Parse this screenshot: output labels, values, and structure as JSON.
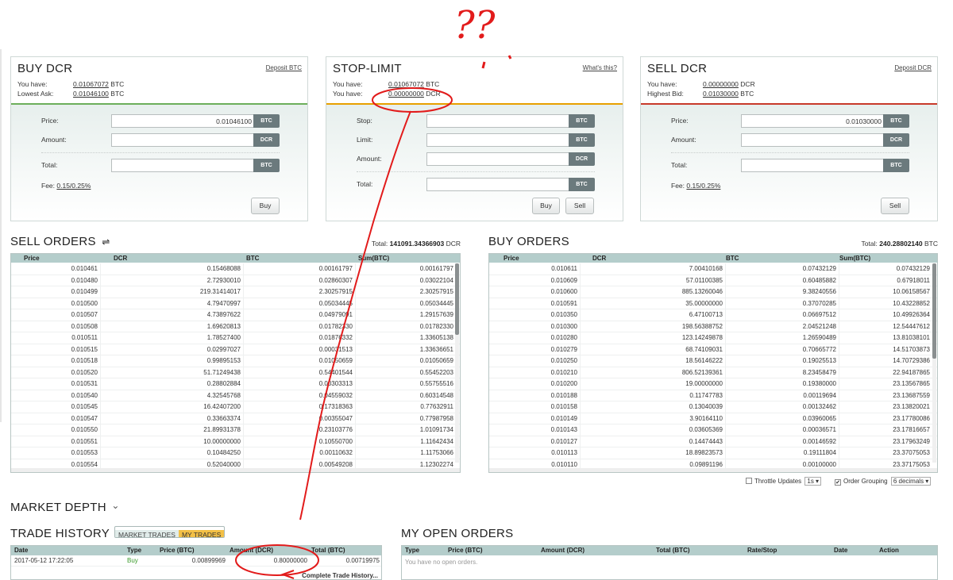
{
  "buy": {
    "title": "BUY DCR",
    "deposit_link": "Deposit BTC",
    "have_label": "You have:",
    "have_value": "0.01067072",
    "have_unit": "BTC",
    "ask_label": "Lowest Ask:",
    "ask_value": "0.01046100",
    "ask_unit": "BTC",
    "price_label": "Price:",
    "price_value": "0.01046100",
    "price_unit": "BTC",
    "amount_label": "Amount:",
    "amount_unit": "DCR",
    "total_label": "Total:",
    "total_unit": "BTC",
    "fee_label": "Fee:",
    "fee_value": "0.15/0.25%",
    "button": "Buy"
  },
  "stop": {
    "title": "STOP-LIMIT",
    "whats_link": "What's this?",
    "have1_label": "You have:",
    "have1_value": "0.01067072",
    "have1_unit": "BTC",
    "have2_label": "You have:",
    "have2_value": "0.00000000",
    "have2_unit": "DCR",
    "stop_label": "Stop:",
    "stop_unit": "BTC",
    "limit_label": "Limit:",
    "limit_unit": "BTC",
    "amount_label": "Amount:",
    "amount_unit": "DCR",
    "total_label": "Total:",
    "total_unit": "BTC",
    "buy_button": "Buy",
    "sell_button": "Sell"
  },
  "sell": {
    "title": "SELL DCR",
    "deposit_link": "Deposit DCR",
    "have_label": "You have:",
    "have_value": "0.00000000",
    "have_unit": "DCR",
    "bid_label": "Highest Bid:",
    "bid_value": "0.01030000",
    "bid_unit": "BTC",
    "price_label": "Price:",
    "price_value": "0.01030000",
    "price_unit": "BTC",
    "amount_label": "Amount:",
    "amount_unit": "DCR",
    "total_label": "Total:",
    "total_unit": "BTC",
    "fee_label": "Fee:",
    "fee_value": "0.15/0.25%",
    "button": "Sell"
  },
  "sell_orders": {
    "title": "SELL ORDERS",
    "toggle_glyph": "⇌",
    "total_label": "Total:",
    "total_value": "141091.34366903",
    "total_unit": "DCR",
    "columns": [
      "Price",
      "DCR",
      "BTC",
      "Sum(BTC)"
    ],
    "rows": [
      [
        "0.010461",
        "0.15468088",
        "0.00161797",
        "0.00161797"
      ],
      [
        "0.010480",
        "2.72930010",
        "0.02860307",
        "0.03022104"
      ],
      [
        "0.010499",
        "219.31414017",
        "2.30257915",
        "2.30257915"
      ],
      [
        "0.010500",
        "4.79470997",
        "0.05034445",
        "0.05034445"
      ],
      [
        "0.010507",
        "4.73897622",
        "0.04979091",
        "1.29157639"
      ],
      [
        "0.010508",
        "1.69620813",
        "0.01782330",
        "0.01782330"
      ],
      [
        "0.010511",
        "1.78527400",
        "0.01876332",
        "1.33605138"
      ],
      [
        "0.010515",
        "0.02997027",
        "0.00031513",
        "1.33636651"
      ],
      [
        "0.010518",
        "0.99895153",
        "0.01050659",
        "0.01050659"
      ],
      [
        "0.010520",
        "51.71249438",
        "0.54401544",
        "0.55452203"
      ],
      [
        "0.010531",
        "0.28802884",
        "0.00303313",
        "0.55755516"
      ],
      [
        "0.010540",
        "4.32545768",
        "0.04559032",
        "0.60314548"
      ],
      [
        "0.010545",
        "16.42407200",
        "0.17318363",
        "0.77632911"
      ],
      [
        "0.010547",
        "0.33663374",
        "0.00355047",
        "0.77987958"
      ],
      [
        "0.010550",
        "21.89931378",
        "0.23103776",
        "1.01091734"
      ],
      [
        "0.010551",
        "10.00000000",
        "0.10550700",
        "1.11642434"
      ],
      [
        "0.010553",
        "0.10484250",
        "0.00110632",
        "1.11753066"
      ],
      [
        "0.010554",
        "0.52040000",
        "0.00549208",
        "1.12302274"
      ]
    ]
  },
  "buy_orders": {
    "title": "BUY ORDERS",
    "total_label": "Total:",
    "total_value": "240.28802140",
    "total_unit": "BTC",
    "columns": [
      "Price",
      "DCR",
      "BTC",
      "Sum(BTC)"
    ],
    "rows": [
      [
        "0.010611",
        "7.00410168",
        "0.07432129",
        "0.07432129"
      ],
      [
        "0.010609",
        "57.01100385",
        "0.60485882",
        "0.67918011"
      ],
      [
        "0.010600",
        "885.13260046",
        "9.38240556",
        "10.06158567"
      ],
      [
        "0.010591",
        "35.00000000",
        "0.37070285",
        "10.43228852"
      ],
      [
        "0.010350",
        "6.47100713",
        "0.06697512",
        "10.49926364"
      ],
      [
        "0.010300",
        "198.56388752",
        "2.04521248",
        "12.54447612"
      ],
      [
        "0.010280",
        "123.14249878",
        "1.26590489",
        "13.81038101"
      ],
      [
        "0.010279",
        "68.74109031",
        "0.70665772",
        "14.51703873"
      ],
      [
        "0.010250",
        "18.56146222",
        "0.19025513",
        "14.70729386"
      ],
      [
        "0.010210",
        "806.52139361",
        "8.23458479",
        "22.94187865"
      ],
      [
        "0.010200",
        "19.00000000",
        "0.19380000",
        "23.13567865"
      ],
      [
        "0.010188",
        "0.11747783",
        "0.00119694",
        "23.13687559"
      ],
      [
        "0.010158",
        "0.13040039",
        "0.00132462",
        "23.13820021"
      ],
      [
        "0.010149",
        "3.90164110",
        "0.03960065",
        "23.17780086"
      ],
      [
        "0.010143",
        "0.03605369",
        "0.00036571",
        "23.17816657"
      ],
      [
        "0.010127",
        "0.14474443",
        "0.00146592",
        "23.17963249"
      ],
      [
        "0.010113",
        "18.89823573",
        "0.19111804",
        "23.37075053"
      ],
      [
        "0.010110",
        "0.09891196",
        "0.00100000",
        "23.37175053"
      ]
    ]
  },
  "options": {
    "throttle_label": "Throttle Updates",
    "throttle_value": "1s",
    "throttle_checked": false,
    "grouping_label": "Order Grouping",
    "grouping_value": "6 decimals",
    "grouping_checked": true
  },
  "market_depth": {
    "title": "MARKET DEPTH",
    "chevron": "⌄"
  },
  "trade_history": {
    "title": "TRADE HISTORY",
    "tabs": [
      "MARKET TRADES",
      "MY TRADES"
    ],
    "active_tab": "MY TRADES",
    "columns": [
      "Date",
      "Type",
      "Price (BTC)",
      "Amount (DCR)",
      "Total (BTC)"
    ],
    "rows": [
      [
        "2017-05-12 17:22:05",
        "Buy",
        "0.00899969",
        "0.80000000",
        "0.00719975"
      ]
    ],
    "complete_link": "Complete Trade History..."
  },
  "open_orders": {
    "title": "MY OPEN ORDERS",
    "columns": [
      "Type",
      "Price (BTC)",
      "Amount (DCR)",
      "Total (BTC)",
      "Rate/Stop",
      "Date",
      "Action"
    ],
    "empty_text": "You have no open orders."
  },
  "annotation": {
    "text": "??",
    "color": "#e21b1b"
  },
  "colors": {
    "buy_accent": "#6cae5b",
    "stop_accent": "#e8a000",
    "sell_accent": "#c83a2a",
    "header_bg": "#b4cdcb",
    "active_tab": "#f3c046",
    "buy_type": "#3a9a2a"
  }
}
